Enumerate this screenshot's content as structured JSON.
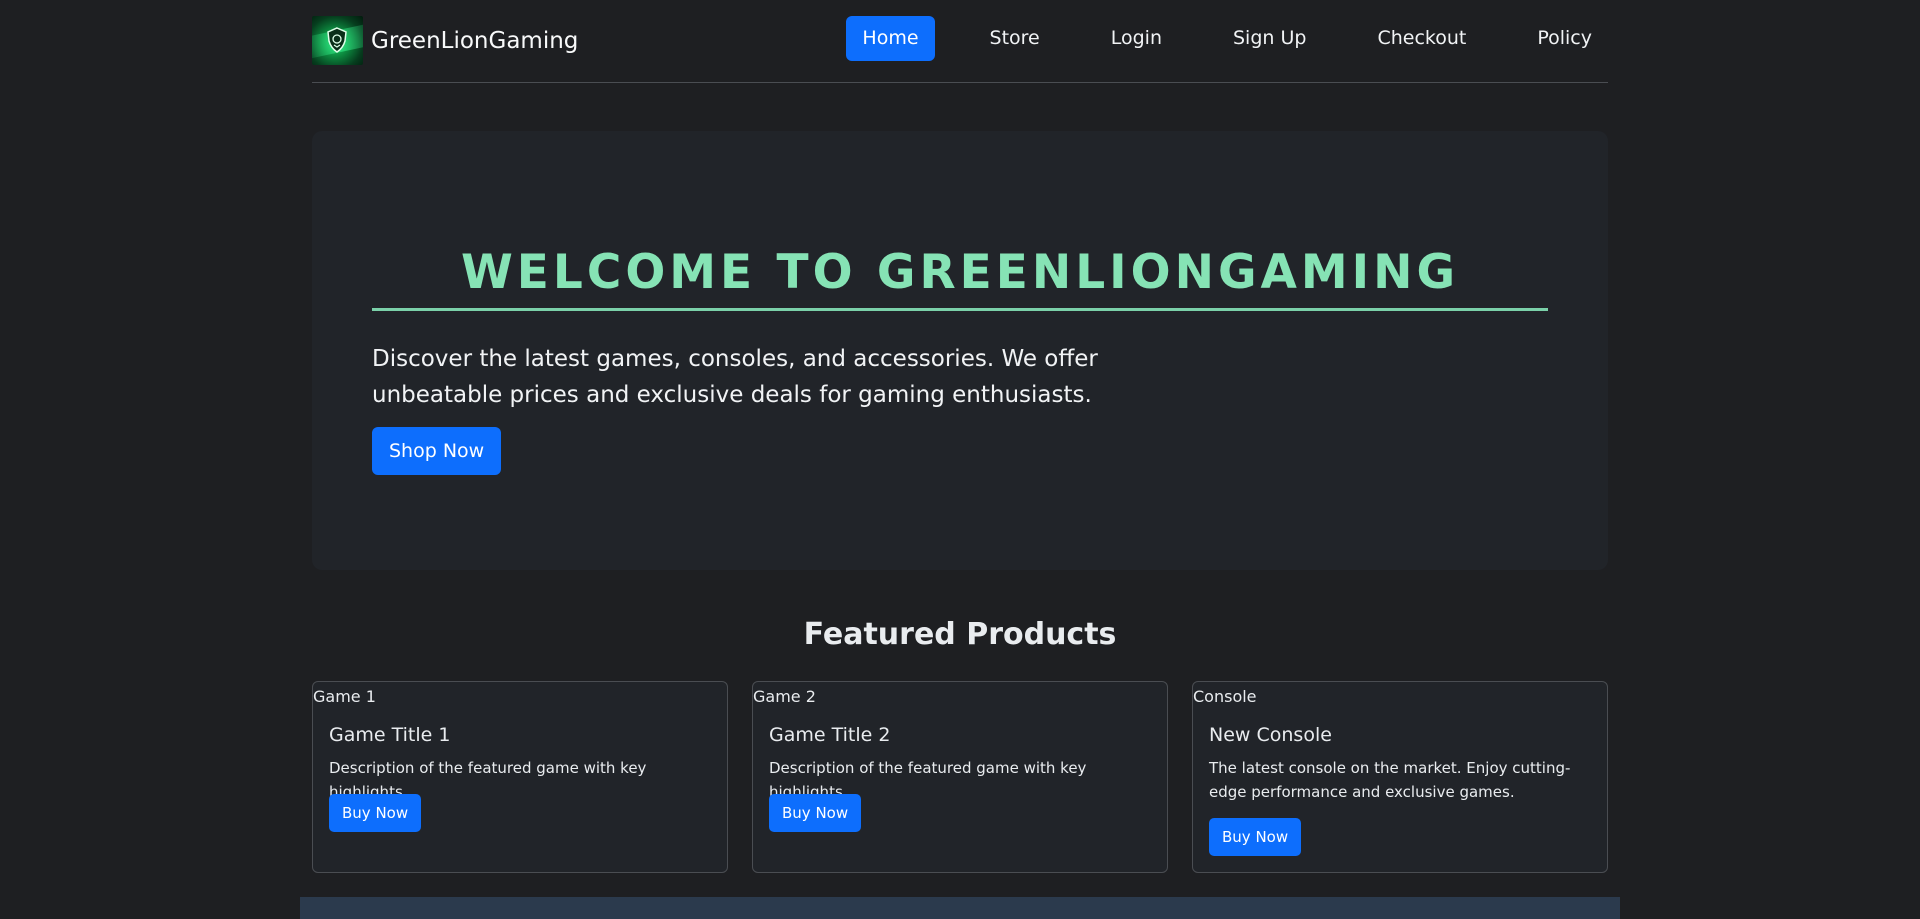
{
  "header": {
    "brand": "GreenLionGaming",
    "logo_icon": "lion-shield-logo",
    "nav": [
      {
        "label": "Home",
        "active": true
      },
      {
        "label": "Store"
      },
      {
        "label": "Login"
      },
      {
        "label": "Sign Up"
      },
      {
        "label": "Checkout"
      },
      {
        "label": "Policy"
      }
    ]
  },
  "hero": {
    "title": "WELCOME TO GREENLIONGAMING",
    "text": "Discover the latest games, consoles, and accessories. We offer unbeatable prices and exclusive deals for gaming enthusiasts.",
    "button": "Shop Now"
  },
  "featured": {
    "title": "Featured Products",
    "cards": [
      {
        "image_alt": "Game 1",
        "title": "Game Title 1",
        "text": "Description of the featured game with key highlights.",
        "button": "Buy Now"
      },
      {
        "image_alt": "Game 2",
        "title": "Game Title 2",
        "text": "Description of the featured game with key highlights.",
        "button": "Buy Now"
      },
      {
        "image_alt": "Console",
        "title": "New Console",
        "text": "The latest console on the market. Enjoy cutting-edge performance and exclusive games.",
        "button": "Buy Now"
      }
    ]
  },
  "colors": {
    "accent": "#0d6efd",
    "hero_title": "#86e3b5",
    "background": "#1e1f22",
    "panel": "#212429"
  }
}
